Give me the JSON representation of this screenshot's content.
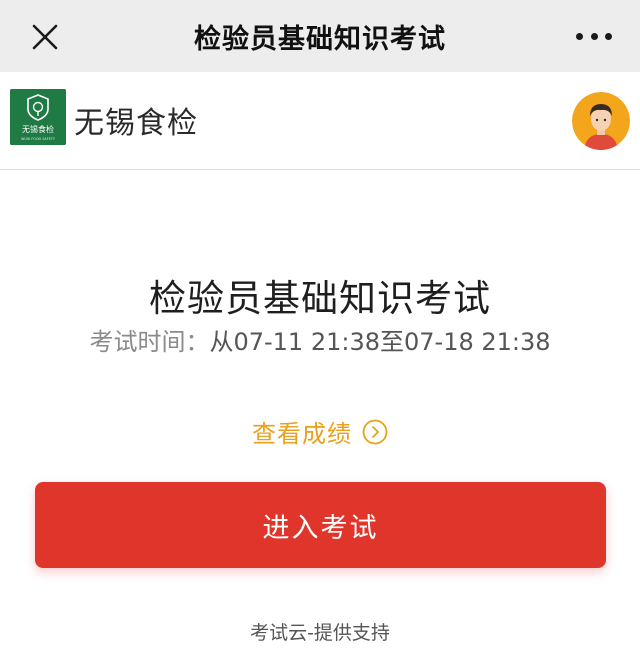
{
  "topbar": {
    "title": "检验员基础知识考试",
    "close_icon": "close-icon",
    "more_icon": "more-dots-icon"
  },
  "brand": {
    "name": "无锡食检",
    "logo_icon": "wuxi-food-inspection-logo",
    "logo_text": "无锡食检",
    "logo_subtext": "WUXI FOOD SAFETY",
    "avatar_icon": "user-avatar-icon"
  },
  "exam": {
    "title": "检验员基础知识考试",
    "time_label": "考试时间：",
    "time_value": "从07-11 21:38至07-18 21:38"
  },
  "actions": {
    "view_score_label": "查看成绩",
    "view_score_icon": "chevron-right-circle-icon",
    "enter_exam_label": "进入考试"
  },
  "footer": {
    "text": "考试云-提供支持"
  },
  "colors": {
    "topbar_bg": "#ededed",
    "brand_green": "#1f7a43",
    "accent_orange": "#e9a01a",
    "primary_red": "#e0352b"
  }
}
